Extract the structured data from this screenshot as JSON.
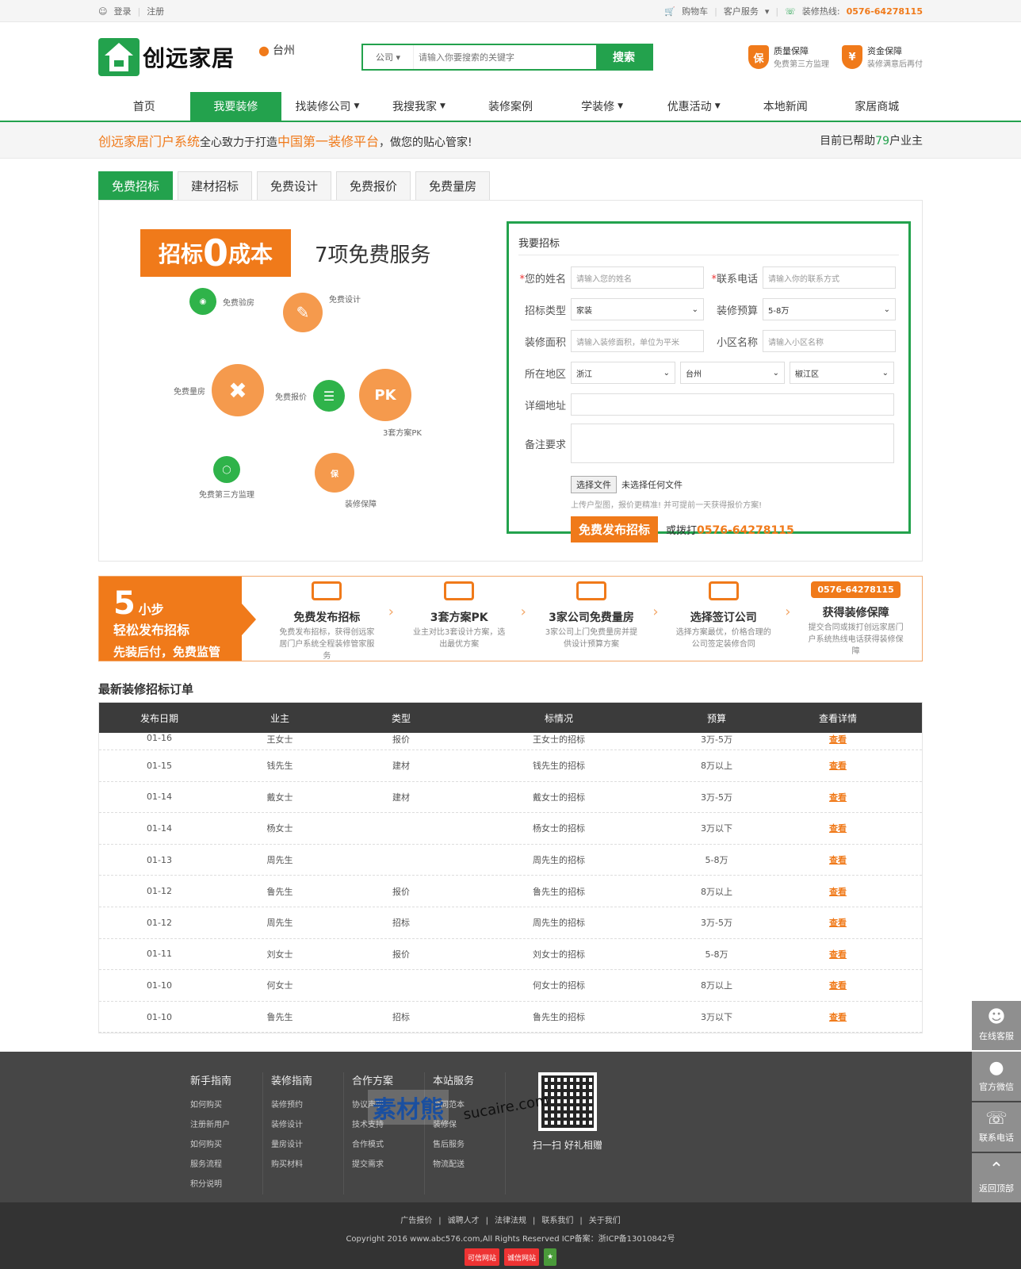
{
  "topbar": {
    "login": "登录",
    "register": "注册",
    "cart": "购物车",
    "customer_service": "客户服务",
    "hotline_label": "装修热线:",
    "hotline_number": "0576-64278115"
  },
  "header": {
    "logo_text": "创远家居",
    "city": "台州",
    "search_type": "公司",
    "search_placeholder": "请输入你要搜索的关键字",
    "search_button": "搜索",
    "guarantees": [
      {
        "icon": "保",
        "title": "质量保障",
        "subtitle": "免费第三方监理"
      },
      {
        "icon": "¥",
        "title": "资金保障",
        "subtitle": "装修满意后再付"
      }
    ]
  },
  "nav": {
    "items": [
      {
        "label": "首页",
        "dropdown": false
      },
      {
        "label": "我要装修",
        "dropdown": false,
        "active": true
      },
      {
        "label": "找装修公司",
        "dropdown": true
      },
      {
        "label": "我搜我家",
        "dropdown": true
      },
      {
        "label": "装修案例",
        "dropdown": false
      },
      {
        "label": "学装修",
        "dropdown": true
      },
      {
        "label": "优惠活动",
        "dropdown": true
      },
      {
        "label": "本地新闻",
        "dropdown": false
      },
      {
        "label": "家居商城",
        "dropdown": false
      }
    ]
  },
  "slogan": {
    "brand": "创远家居门户系统",
    "mid1": "全心致力于打造",
    "highlight": "中国第一装修平台",
    "mid2": "，做您的贴心管家!",
    "right_prefix": "目前已帮助",
    "right_count": "79",
    "right_suffix": "户业主"
  },
  "tabs": [
    "免费招标",
    "建材招标",
    "免费设计",
    "免费报价",
    "免费量房"
  ],
  "promo": {
    "box_left": "招标",
    "box_zero": "0",
    "box_right": "成本",
    "title": "7项免费服务",
    "services": [
      "免费验房",
      "免费设计",
      "免费量房",
      "免费报价",
      "3套方案PK",
      "免费第三方监理",
      "装修保障"
    ]
  },
  "form": {
    "title": "我要招标",
    "name_label": "您的姓名",
    "name_placeholder": "请输入您的姓名",
    "phone_label": "联系电话",
    "phone_placeholder": "请输入你的联系方式",
    "type_label": "招标类型",
    "type_value": "家装",
    "budget_label": "装修预算",
    "budget_value": "5-8万",
    "area_label": "装修面积",
    "area_placeholder": "请输入装修面积，单位为平米",
    "community_label": "小区名称",
    "community_placeholder": "请输入小区名称",
    "region_label": "所在地区",
    "province": "浙江",
    "city": "台州",
    "district": "椒江区",
    "address_label": "详细地址",
    "notes_label": "备注要求",
    "file_button": "选择文件",
    "file_status": "未选择任何文件",
    "hint": "上传户型图，报价更精准! 并可提前一天获得报价方案!",
    "submit": "免费发布招标",
    "or_call": "或拨打",
    "phone": "0576-64278115"
  },
  "steps": {
    "num": "5",
    "small": "小步",
    "line2": "轻松发布招标",
    "foot": "先装后付，免费监管",
    "items": [
      {
        "title": "免费发布招标",
        "desc": "免费发布招标，获得创远家居门户系统全程装修管家服务"
      },
      {
        "title": "3套方案PK",
        "desc": "业主对比3套设计方案，选出最优方案"
      },
      {
        "title": "3家公司免费量房",
        "desc": "3家公司上门免费量房并提供设计预算方案"
      },
      {
        "title": "选择签订公司",
        "desc": "选择方案最优，价格合理的公司签定装修合同"
      },
      {
        "title": "获得装修保障",
        "desc": "提交合同或拨打创远家居门户系统热线电话获得装修保障",
        "phone": "0576-64278115"
      }
    ]
  },
  "orders": {
    "title": "最新装修招标订单",
    "headers": [
      "发布日期",
      "业主",
      "类型",
      "标情况",
      "预算",
      "查看详情"
    ],
    "rows": [
      [
        "01-16",
        "王女士",
        "报价",
        "王女士的招标",
        "3万-5万",
        "查看"
      ],
      [
        "01-15",
        "钱先生",
        "建材",
        "钱先生的招标",
        "8万以上",
        "查看"
      ],
      [
        "01-14",
        "戴女士",
        "建材",
        "戴女士的招标",
        "3万-5万",
        "查看"
      ],
      [
        "01-14",
        "杨女士",
        "",
        "杨女士的招标",
        "3万以下",
        "查看"
      ],
      [
        "01-13",
        "周先生",
        "",
        "周先生的招标",
        "5-8万",
        "查看"
      ],
      [
        "01-12",
        "鲁先生",
        "报价",
        "鲁先生的招标",
        "8万以上",
        "查看"
      ],
      [
        "01-12",
        "周先生",
        "招标",
        "周先生的招标",
        "3万-5万",
        "查看"
      ],
      [
        "01-11",
        "刘女士",
        "报价",
        "刘女士的招标",
        "5-8万",
        "查看"
      ],
      [
        "01-10",
        "何女士",
        "",
        "何女士的招标",
        "8万以上",
        "查看"
      ],
      [
        "01-10",
        "鲁先生",
        "招标",
        "鲁先生的招标",
        "3万以下",
        "查看"
      ]
    ]
  },
  "footer": {
    "columns": [
      {
        "title": "新手指南",
        "items": [
          "如何购买",
          "注册新用户",
          "如何购买",
          "服务流程",
          "积分说明"
        ]
      },
      {
        "title": "装修指南",
        "items": [
          "装修预约",
          "装修设计",
          "量房设计",
          "购买材料"
        ]
      },
      {
        "title": "合作方案",
        "items": [
          "协议声明",
          "技术支持",
          "合作模式",
          "提交需求"
        ]
      },
      {
        "title": "本站服务",
        "items": [
          "合同范本",
          "装修保",
          "售后服务",
          "物流配送"
        ]
      }
    ],
    "qr_caption": "扫一扫 好礼相赠",
    "watermark": "素材熊",
    "watermark_url": "sucaire.com",
    "links": [
      "广告报价",
      "诚聘人才",
      "法律法规",
      "联系我们",
      "关于我们"
    ],
    "copyright": "Copyright 2016 www.abc576.com,All Rights Reserved ICP备案：浙ICP备13010842号",
    "badges": [
      "可信网站",
      "诚信网站"
    ]
  },
  "floatbar": [
    "在线客服",
    "官方微信",
    "联系电话",
    "返回顶部"
  ]
}
